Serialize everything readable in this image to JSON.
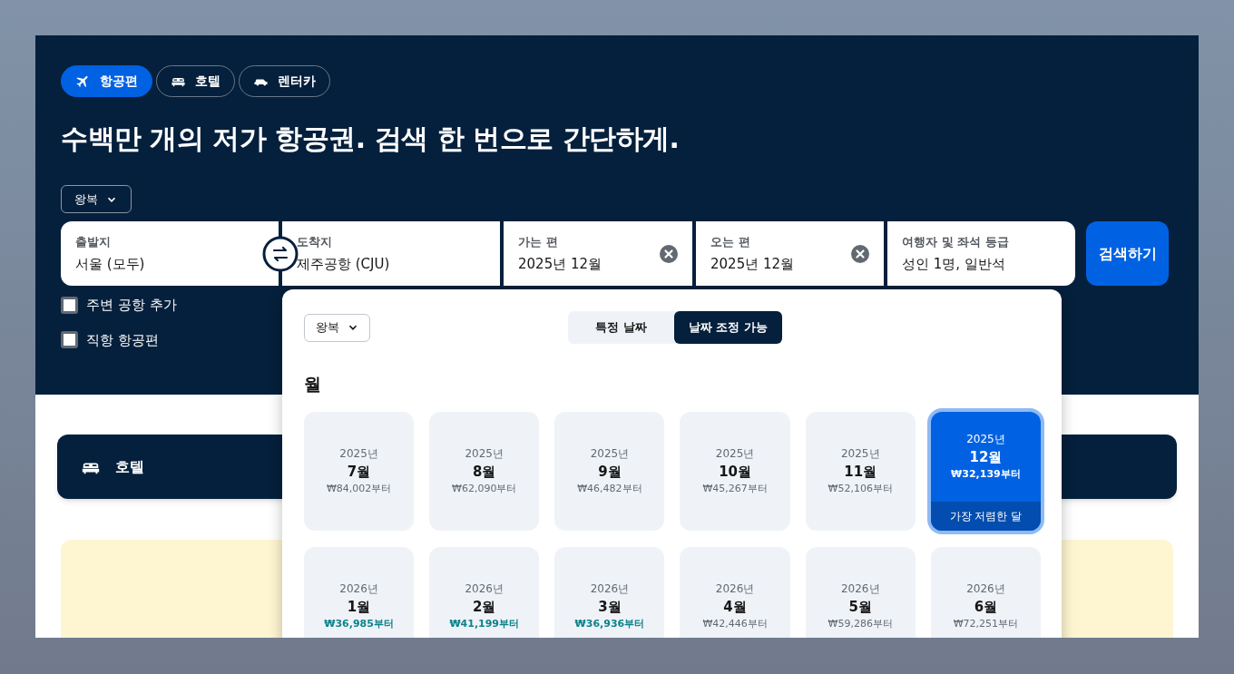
{
  "product_tabs": [
    {
      "kind": "flight",
      "label": "항공편",
      "selected": true
    },
    {
      "kind": "hotel",
      "label": "호텔",
      "selected": false
    },
    {
      "kind": "car",
      "label": "렌터카",
      "selected": false
    }
  ],
  "headline": "수백만 개의 저가 항공권. 검색 한 번으로 간단하게.",
  "trip_type": "왕복",
  "search_fields": [
    {
      "label": "출발지",
      "value": "서울 (모두)",
      "clearable": false
    },
    {
      "label": "도착지",
      "value": "제주공항 (CJU)",
      "clearable": false
    },
    {
      "label": "가는 편",
      "value": "2025년 12월",
      "clearable": true
    },
    {
      "label": "오는 편",
      "value": "2025년 12월",
      "clearable": true
    },
    {
      "label": "여행자 및 좌석 등급",
      "value": "성인 1명, 일반석",
      "clearable": false
    }
  ],
  "search_button": "검색하기",
  "options": [
    {
      "label": "주변 공항 추가",
      "checked": false
    },
    {
      "label": "직항 항공편",
      "checked": false
    }
  ],
  "date_picker": {
    "trip_type": "왕복",
    "modes": [
      {
        "label": "특정 날짜",
        "selected": false
      },
      {
        "label": "날짜 조정 가능",
        "selected": true
      }
    ],
    "section_title": "월",
    "months": [
      {
        "year": "2025년",
        "month": "7월",
        "price": "₩84,002부터",
        "price_highlight": false,
        "selected": false
      },
      {
        "year": "2025년",
        "month": "8월",
        "price": "₩62,090부터",
        "price_highlight": false,
        "selected": false
      },
      {
        "year": "2025년",
        "month": "9월",
        "price": "₩46,482부터",
        "price_highlight": false,
        "selected": false
      },
      {
        "year": "2025년",
        "month": "10월",
        "price": "₩45,267부터",
        "price_highlight": false,
        "selected": false
      },
      {
        "year": "2025년",
        "month": "11월",
        "price": "₩52,106부터",
        "price_highlight": false,
        "selected": false
      },
      {
        "year": "2025년",
        "month": "12월",
        "price": "₩32,139부터",
        "price_highlight": false,
        "selected": true,
        "badge": "가장 저렴한 달"
      },
      {
        "year": "2026년",
        "month": "1월",
        "price": "₩36,985부터",
        "price_highlight": true,
        "selected": false
      },
      {
        "year": "2026년",
        "month": "2월",
        "price": "₩41,199부터",
        "price_highlight": true,
        "selected": false
      },
      {
        "year": "2026년",
        "month": "3월",
        "price": "₩36,936부터",
        "price_highlight": true,
        "selected": false
      },
      {
        "year": "2026년",
        "month": "4월",
        "price": "₩42,446부터",
        "price_highlight": false,
        "selected": false
      },
      {
        "year": "2026년",
        "month": "5월",
        "price": "₩59,286부터",
        "price_highlight": false,
        "selected": false
      },
      {
        "year": "2026년",
        "month": "6월",
        "price": "₩72,251부터",
        "price_highlight": false,
        "selected": false
      }
    ]
  },
  "hotel_banner": {
    "label": "호텔"
  }
}
